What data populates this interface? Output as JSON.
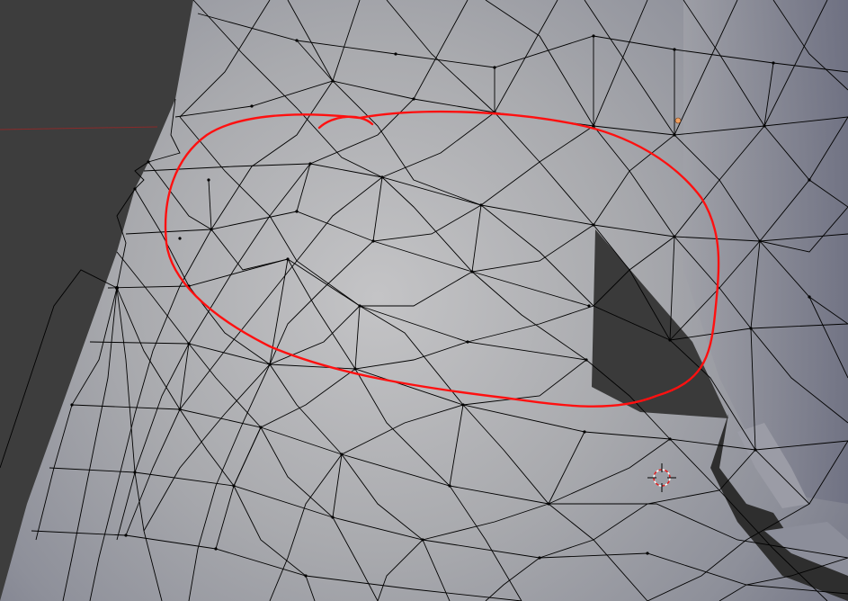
{
  "viewport": {
    "mode": "edit-mesh",
    "shading": "solid-wireframe",
    "background_color": "#3d3d3d",
    "mesh_color_light": "#c4c4c6",
    "mesh_color_mid": "#9fa0a6",
    "mesh_color_dark": "#6e7081",
    "hole_color": "#3a3a3a",
    "wire_color": "#000000",
    "vertex_color": "#000000",
    "annotation_color": "#ff1010",
    "x_axis_color": "#8a2a2a",
    "y_axis_color": "#4f9a4f",
    "pivot_color": "#f0a060"
  },
  "overlays": {
    "annotation": "red-hand-drawn-circle",
    "cursor": "3d-cursor-icon",
    "pivot": "origin-dot"
  }
}
